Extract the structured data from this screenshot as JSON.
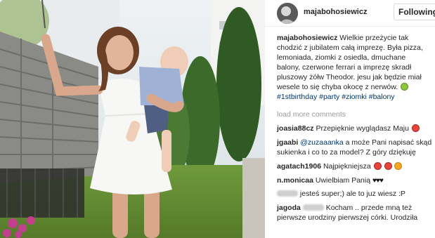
{
  "post": {
    "username": "majabohosiewicz",
    "follow_label": "Following",
    "caption_username": "majabohosiewicz",
    "caption_text": "Wielkie przeżycie tak chodzić z jubilatem całą imprezę. Była pizza, lemoniada, ziomki z osiedla, dmuchane balony, czerwone ferrari a imprezę skradł pluszowy żółw Theodor. jesu jak będzie miał wesele to się chyba okocę z nerwów.",
    "caption_emoji": "grinning-face-emoji",
    "hashtags": [
      "#1stbirthday",
      "#party",
      "#ziomki",
      "#balony"
    ]
  },
  "load_more_label": "load more comments",
  "comments": [
    {
      "username": "joasia88cz",
      "text": "Przepięknie wyglądasz Maju",
      "emoji": "heart-eyes-emoji"
    },
    {
      "username": "jgaabi",
      "mention": "@zuzaaanka",
      "text": "a może Pani napisać skąd sukienka i co to za model? Z góry dziękuję"
    },
    {
      "username": "agatach1906",
      "text": "Najpiękniejsza",
      "emoji": "heart-eyes-emoji x3"
    },
    {
      "username": "n.monicaa",
      "text": "Uwielbiam Panią",
      "hearts": "♥♥♥"
    },
    {
      "username": "",
      "text": "jesteś super;) ale to juz wiesz :P"
    },
    {
      "username": "jagoda",
      "text": "Kocham .. przede mną też pierwsze urodziny pierwszej córki. Urodziła"
    }
  ],
  "icons": {
    "avatar": "profile-avatar",
    "emoji_green": "#8cc63f",
    "emoji_red": "#e8443a"
  }
}
